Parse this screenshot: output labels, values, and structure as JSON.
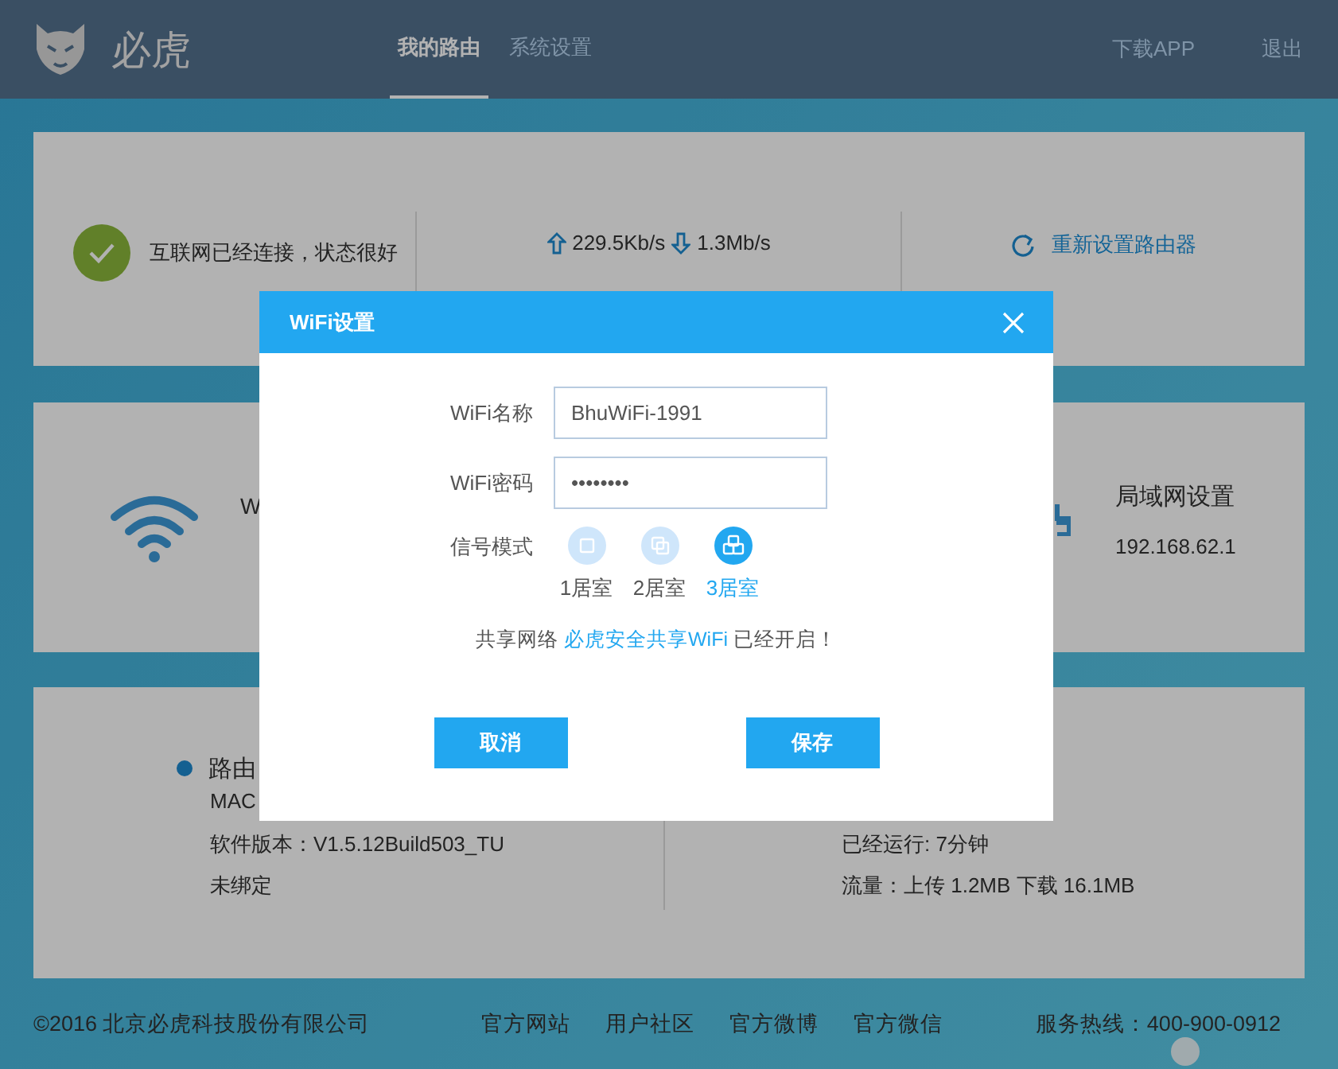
{
  "header": {
    "logo_text": "必虎",
    "tabs": [
      {
        "label": "我的路由",
        "selected": true
      },
      {
        "label": "系统设置",
        "selected": false
      }
    ],
    "links": [
      "下载APP",
      "退出"
    ]
  },
  "status_card": {
    "internet": "互联网已经连接，状态很好",
    "upload": "229.5Kb/s",
    "download": "1.3Mb/s",
    "reset_link": "重新设置路由器"
  },
  "wifi_card": {
    "left_title": "W",
    "lan_title": "局域网设置",
    "lan_ip": "192.168.62.1"
  },
  "info_card": {
    "title": "路由",
    "left_lines": [
      "MAC",
      "软件版本：V1.5.12Build503_TU",
      "未绑定"
    ],
    "right_lines": [
      "已经运行: 7分钟",
      "流量：上传 1.2MB 下载 16.1MB"
    ]
  },
  "footer": {
    "copyright": "©2016 北京必虎科技股份有限公司",
    "links": [
      "官方网站",
      "用户社区",
      "官方微博",
      "官方微信"
    ],
    "hotline": "服务热线：400-900-0912"
  },
  "dialog": {
    "title": "WiFi设置",
    "fields": [
      {
        "label": "WiFi名称",
        "value": "BhuWiFi-1991"
      },
      {
        "label": "WiFi密码",
        "value": "••••••••"
      }
    ],
    "mode_label": "信号模式",
    "modes": [
      {
        "label": "1居室",
        "selected": false
      },
      {
        "label": "2居室",
        "selected": false
      },
      {
        "label": "3居室",
        "selected": true
      }
    ],
    "share_prefix": "共享网络",
    "share_link": "必虎安全共享WiFi",
    "share_suffix": "已经开启！",
    "buttons": [
      "取消",
      "保存"
    ]
  }
}
